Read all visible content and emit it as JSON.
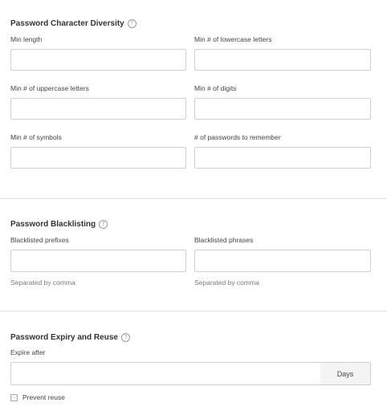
{
  "diversity": {
    "title": "Password Character Diversity",
    "help_icon": "question-circle-icon",
    "min_length_label": "Min length",
    "min_lowercase_label": "Min # of lowercase letters",
    "min_uppercase_label": "Min # of uppercase letters",
    "min_digits_label": "Min # of digits",
    "min_symbols_label": "Min # of symbols",
    "passwords_remember_label": "# of passwords to remember"
  },
  "blacklisting": {
    "title": "Password Blacklisting",
    "help_icon": "question-circle-icon",
    "prefixes_label": "Blacklisted prefixes",
    "phrases_label": "Blacklisted phrases",
    "prefixes_hint": "Separated by comma",
    "phrases_hint": "Separated by comma"
  },
  "expiry": {
    "title": "Password Expiry and Reuse",
    "help_icon": "question-circle-icon",
    "expire_label": "Expire after",
    "unit_label": "Days",
    "prevent_reuse_label": "Prevent reuse",
    "prevent_reuse_checked": false
  }
}
